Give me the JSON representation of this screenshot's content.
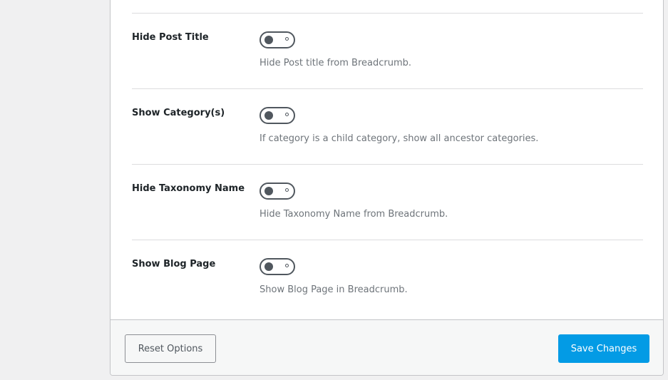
{
  "options": [
    {
      "label": "Hide Post Title",
      "description": "Hide Post title from Breadcrumb.",
      "enabled": false
    },
    {
      "label": "Show Category(s)",
      "description": "If category is a child category, show all ancestor categories.",
      "enabled": false
    },
    {
      "label": "Hide Taxonomy Name",
      "description": "Hide Taxonomy Name from Breadcrumb.",
      "enabled": false
    },
    {
      "label": "Show Blog Page",
      "description": "Show Blog Page in Breadcrumb.",
      "enabled": false
    }
  ],
  "footer": {
    "reset_label": "Reset Options",
    "save_label": "Save Changes"
  },
  "colors": {
    "primary": "#039be5",
    "toggle": "#50575e",
    "page_background": "#f0f0f1",
    "panel_background": "#ffffff",
    "footer_background": "#f6f7f7"
  }
}
